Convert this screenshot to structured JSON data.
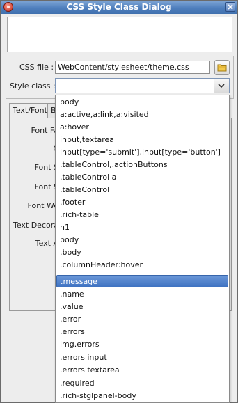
{
  "window": {
    "title": "CSS Style Class Dialog"
  },
  "form": {
    "css_file_label": "CSS file :",
    "css_file_value": "WebContent/stylesheet/theme.css",
    "style_class_label": "Style class :"
  },
  "tabs": [
    {
      "label": "Text/Font",
      "active": true
    },
    {
      "label": "B",
      "active": false
    }
  ],
  "font_fields": [
    {
      "label": "Font Fa"
    },
    {
      "label": "C"
    },
    {
      "label": "Font S"
    },
    {
      "label": "Font S"
    },
    {
      "label": "Font We"
    },
    {
      "label": "Text Decora"
    },
    {
      "label": "Text A"
    }
  ],
  "dropdown": {
    "selected_index": 14,
    "items": [
      "body",
      "a:active,a:link,a:visited",
      "a:hover",
      "input,textarea",
      "input[type='submit'],input[type='button']",
      ".tableControl,.actionButtons",
      ".tableControl a",
      ".tableControl",
      ".footer",
      ".rich-table",
      "h1",
      "body",
      ".body",
      ".columnHeader:hover",
      ".message",
      ".name",
      ".value",
      ".error",
      ".errors",
      "img.errors",
      ".errors input",
      ".errors textarea",
      ".required",
      ".rich-stglpanel-body"
    ]
  },
  "icons": {
    "app": "app-icon",
    "close": "close-icon",
    "folder": "folder-icon",
    "dropdown_arrow": "chevron-down-icon"
  }
}
